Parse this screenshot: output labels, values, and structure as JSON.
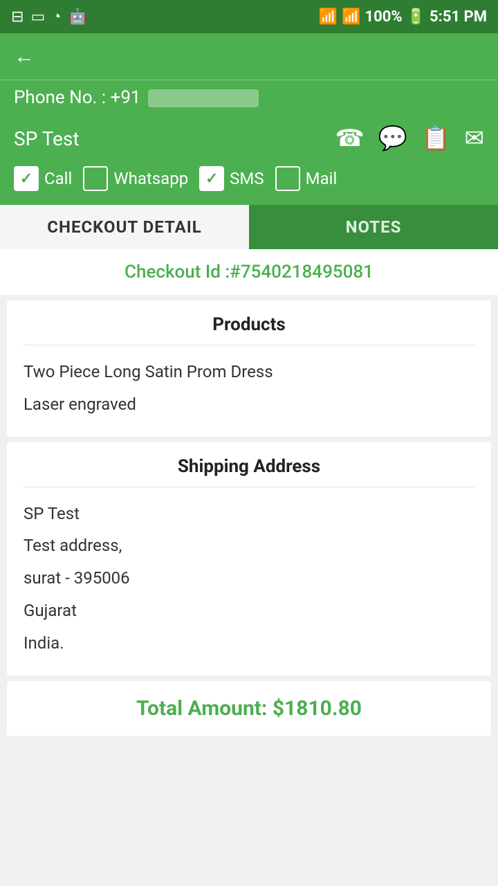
{
  "statusBar": {
    "time": "5:51 PM",
    "battery": "100%",
    "icons": [
      "screen-icon",
      "image-icon",
      "clock-icon",
      "android-icon",
      "wifi-icon",
      "signal-icon",
      "battery-icon"
    ]
  },
  "header": {
    "backLabel": "←"
  },
  "phonebar": {
    "label": "Phone No. : +91",
    "number": "XXXXXXXXXX"
  },
  "contact": {
    "name": "SP Test",
    "icons": {
      "call": "📞",
      "whatsapp": "📲",
      "sms": "💬",
      "mail": "✉"
    }
  },
  "checkboxes": [
    {
      "id": "call",
      "label": "Call",
      "checked": true
    },
    {
      "id": "whatsapp",
      "label": "Whatsapp",
      "checked": false
    },
    {
      "id": "sms",
      "label": "SMS",
      "checked": true
    },
    {
      "id": "mail",
      "label": "Mail",
      "checked": false
    }
  ],
  "tabs": [
    {
      "id": "checkout",
      "label": "CHECKOUT DETAIL",
      "active": true
    },
    {
      "id": "notes",
      "label": "NOTES",
      "active": false
    }
  ],
  "checkoutId": {
    "label": "Checkout Id :#7540218495081"
  },
  "products": {
    "title": "Products",
    "items": [
      "Two Piece Long Satin Prom Dress",
      "Laser engraved"
    ]
  },
  "shippingAddress": {
    "title": "Shipping Address",
    "lines": [
      "SP Test",
      "Test address,",
      "surat - 395006",
      "Gujarat",
      "India."
    ]
  },
  "total": {
    "label": "Total Amount: $1810.80"
  }
}
